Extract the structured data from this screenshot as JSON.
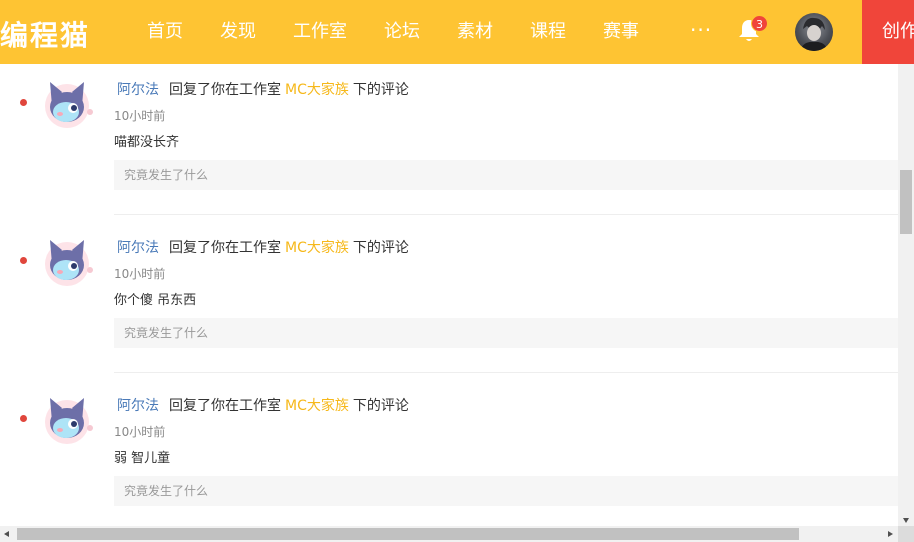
{
  "header": {
    "logo": "编程猫",
    "nav": [
      "首页",
      "发现",
      "工作室",
      "论坛",
      "素材",
      "课程",
      "赛事"
    ],
    "more": "···",
    "notification_count": "3",
    "create_label": "创作"
  },
  "colors": {
    "brand": "#fec433",
    "accent_red": "#f0453a",
    "link_blue": "#4a7ab8",
    "studio_gold": "#f6b81a"
  },
  "notifications": [
    {
      "user": "阿尔法",
      "action": "回复了你在工作室",
      "studio": "MC大家族",
      "suffix": "下的评论",
      "time": "10小时前",
      "comment": "喵都没长齐",
      "reply_placeholder": "究竟发生了什么"
    },
    {
      "user": "阿尔法",
      "action": "回复了你在工作室",
      "studio": "MC大家族",
      "suffix": "下的评论",
      "time": "10小时前",
      "comment": "你个傻 吊东西",
      "reply_placeholder": "究竟发生了什么"
    },
    {
      "user": "阿尔法",
      "action": "回复了你在工作室",
      "studio": "MC大家族",
      "suffix": "下的评论",
      "time": "10小时前",
      "comment": "弱 智儿童",
      "reply_placeholder": "究竟发生了什么"
    }
  ]
}
